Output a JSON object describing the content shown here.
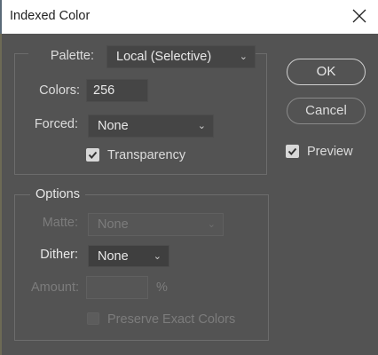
{
  "window": {
    "title": "Indexed Color",
    "close_icon": "close-icon"
  },
  "palette_group": {
    "palette_label": "Palette:",
    "palette_value": "Local (Selective)",
    "colors_label": "Colors:",
    "colors_value": "256",
    "forced_label": "Forced:",
    "forced_value": "None",
    "transparency_label": "Transparency",
    "transparency_checked": true
  },
  "options_group": {
    "title": "Options",
    "matte_label": "Matte:",
    "matte_value": "None",
    "matte_enabled": false,
    "dither_label": "Dither:",
    "dither_value": "None",
    "amount_label": "Amount:",
    "amount_value": "",
    "amount_unit": "%",
    "amount_enabled": false,
    "preserve_label": "Preserve Exact Colors",
    "preserve_checked": false,
    "preserve_enabled": false
  },
  "buttons": {
    "ok": "OK",
    "cancel": "Cancel"
  },
  "preview": {
    "label": "Preview",
    "checked": true
  },
  "colors": {
    "background": "#535353",
    "field": "#454545",
    "text": "#dcdcdc",
    "disabled_text": "#7c7c7c"
  }
}
